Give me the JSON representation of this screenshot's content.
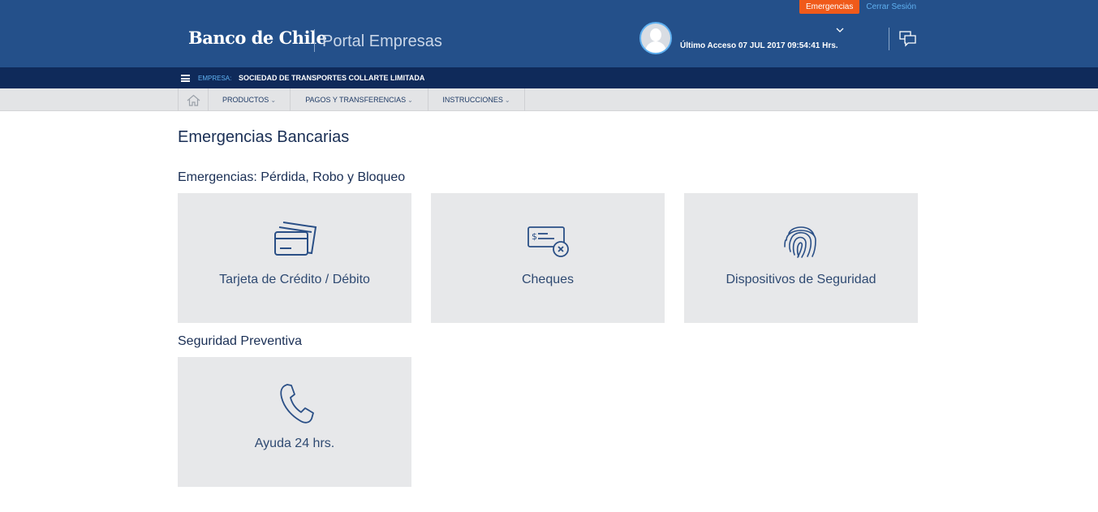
{
  "header": {
    "emergencias_button": "Emergencias",
    "logout_link": "Cerrar Sesión",
    "logo": "Banco de Chile",
    "portal_title": "Portal Empresas",
    "last_access": "Último Acceso 07 JUL 2017 09:54:41 Hrs."
  },
  "empresa_bar": {
    "label": "EMPRESA:",
    "name": "SOCIEDAD DE TRANSPORTES COLLARTE LIMITADA"
  },
  "nav": {
    "items": [
      {
        "label": "PRODUCTOS"
      },
      {
        "label": "PAGOS Y TRANSFERENCIAS"
      },
      {
        "label": "INSTRUCCIONES"
      }
    ]
  },
  "main": {
    "page_title": "Emergencias Bancarias",
    "sections": [
      {
        "title": "Emergencias: Pérdida, Robo y Bloqueo",
        "cards": [
          {
            "label": "Tarjeta de Crédito / Débito",
            "icon": "credit-card-icon"
          },
          {
            "label": "Cheques",
            "icon": "cheque-icon"
          },
          {
            "label": "Dispositivos de Seguridad",
            "icon": "fingerprint-icon"
          }
        ]
      },
      {
        "title": "Seguridad Preventiva",
        "cards": [
          {
            "label": "Ayuda 24 hrs.",
            "icon": "phone-icon"
          }
        ]
      }
    ]
  },
  "colors": {
    "header_bg": "#24508a",
    "empresa_bar_bg": "#0f2a5a",
    "nav_bg": "#e3e4e6",
    "accent_orange": "#f05a1a",
    "link_blue": "#5fb0f0",
    "card_bg": "#e7e8ea",
    "icon_blue": "#2a4f86"
  }
}
